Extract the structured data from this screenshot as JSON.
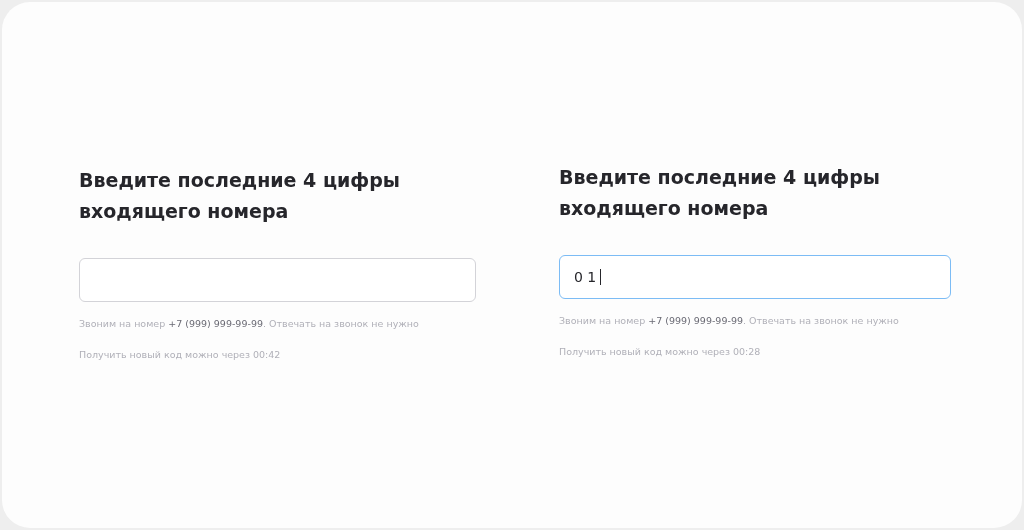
{
  "panels": [
    {
      "title": "Введите последние 4 цифры входящего номера",
      "input": {
        "focused": false
      },
      "notice": "Звоним на номер **+7 (999) 999-99-99**. Отвечать на звонок не нужно",
      "timer": "Получить новый код можно через 00:42"
    },
    {
      "title": "Введите последние 4 цифры входящего номера",
      "input": {
        "value": "0 1",
        "focused": true
      },
      "notice": "Звоним на номер **+7 (999) 999-99-99**. Отвечать на звонок не нужно",
      "timer": "Получить новый код можно через 00:28"
    }
  ]
}
